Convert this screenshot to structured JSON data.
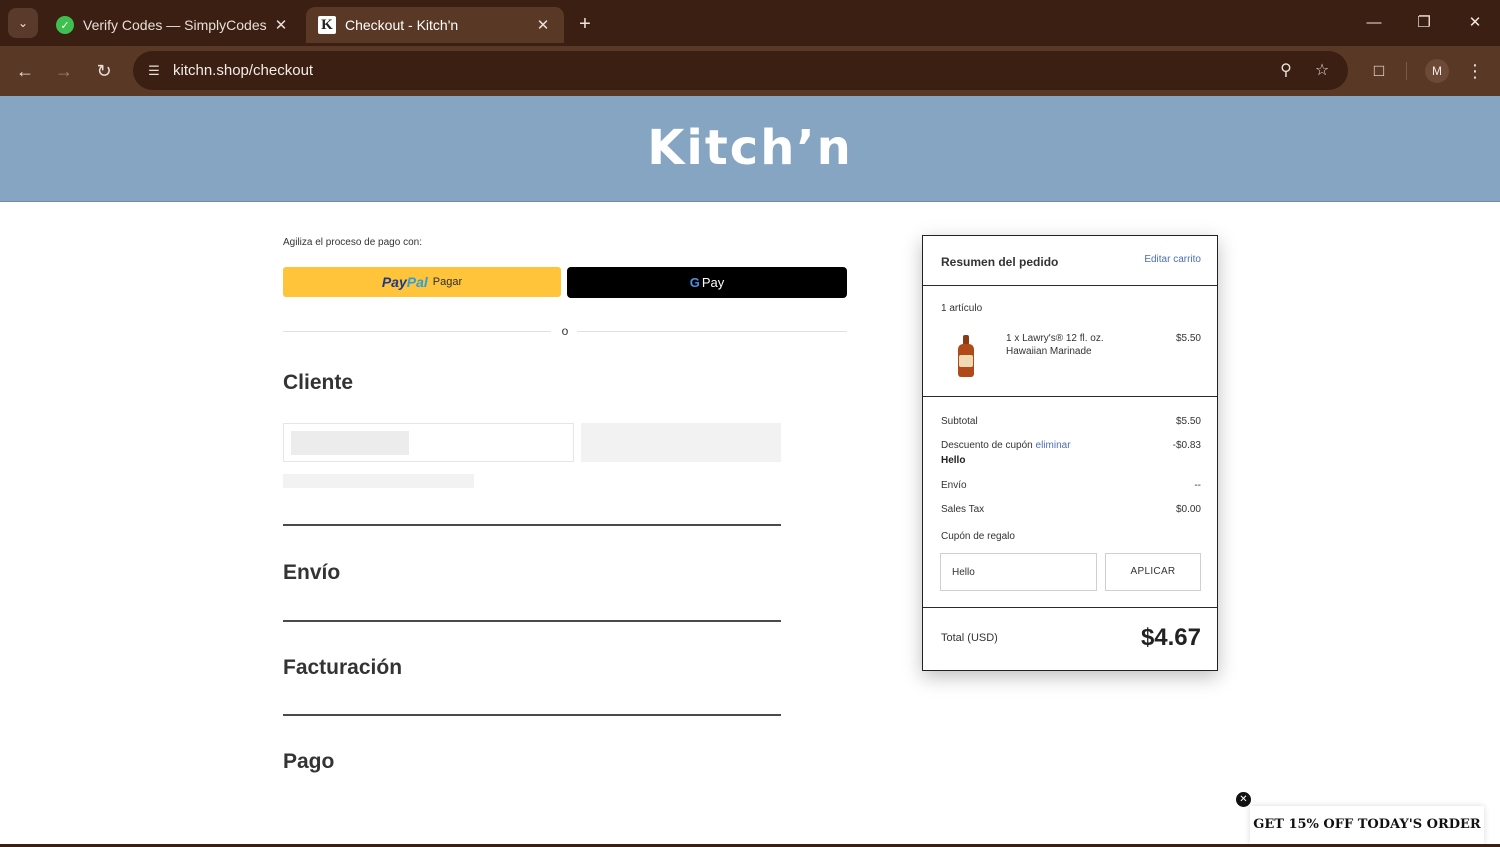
{
  "browser": {
    "tabs": [
      {
        "title": "Verify Codes — SimplyCodes",
        "active": false
      },
      {
        "title": "Checkout - Kitch'n",
        "active": true
      }
    ],
    "url": "kitchn.shop/checkout",
    "profile_initial": "M"
  },
  "site": {
    "logo": "Kitch’n",
    "header_color": "#85a5c3"
  },
  "express": {
    "label": "Agiliza el proceso de pago con:",
    "paypal_pay": "Pay",
    "paypal_pal": "Pal",
    "paypal_label": "Pagar",
    "gpay_g": "G",
    "gpay_label": "Pay",
    "divider": "o"
  },
  "sections": {
    "cliente": "Cliente",
    "envio": "Envío",
    "facturacion": "Facturación",
    "pago": "Pago"
  },
  "summary": {
    "title": "Resumen del pedido",
    "edit_link": "Editar carrito",
    "count": "1 artículo",
    "item": {
      "name": "1 x Lawry's® 12 fl. oz. Hawaiian Marinade",
      "price": "$5.50"
    },
    "subtotal_label": "Subtotal",
    "subtotal_value": "$5.50",
    "discount_label": "Descuento de cupón",
    "discount_remove": "eliminar",
    "discount_value": "-$0.83",
    "discount_code": "Hello",
    "shipping_label": "Envío",
    "shipping_value": "--",
    "tax_label": "Sales Tax",
    "tax_value": "$0.00",
    "gift_label": "Cupón de regalo",
    "gift_input_value": "Hello",
    "apply_label": "APLICAR",
    "total_label": "Total (USD)",
    "total_value": "$4.67"
  },
  "promo": {
    "text": "GET 15% OFF TODAY'S ORDER"
  }
}
